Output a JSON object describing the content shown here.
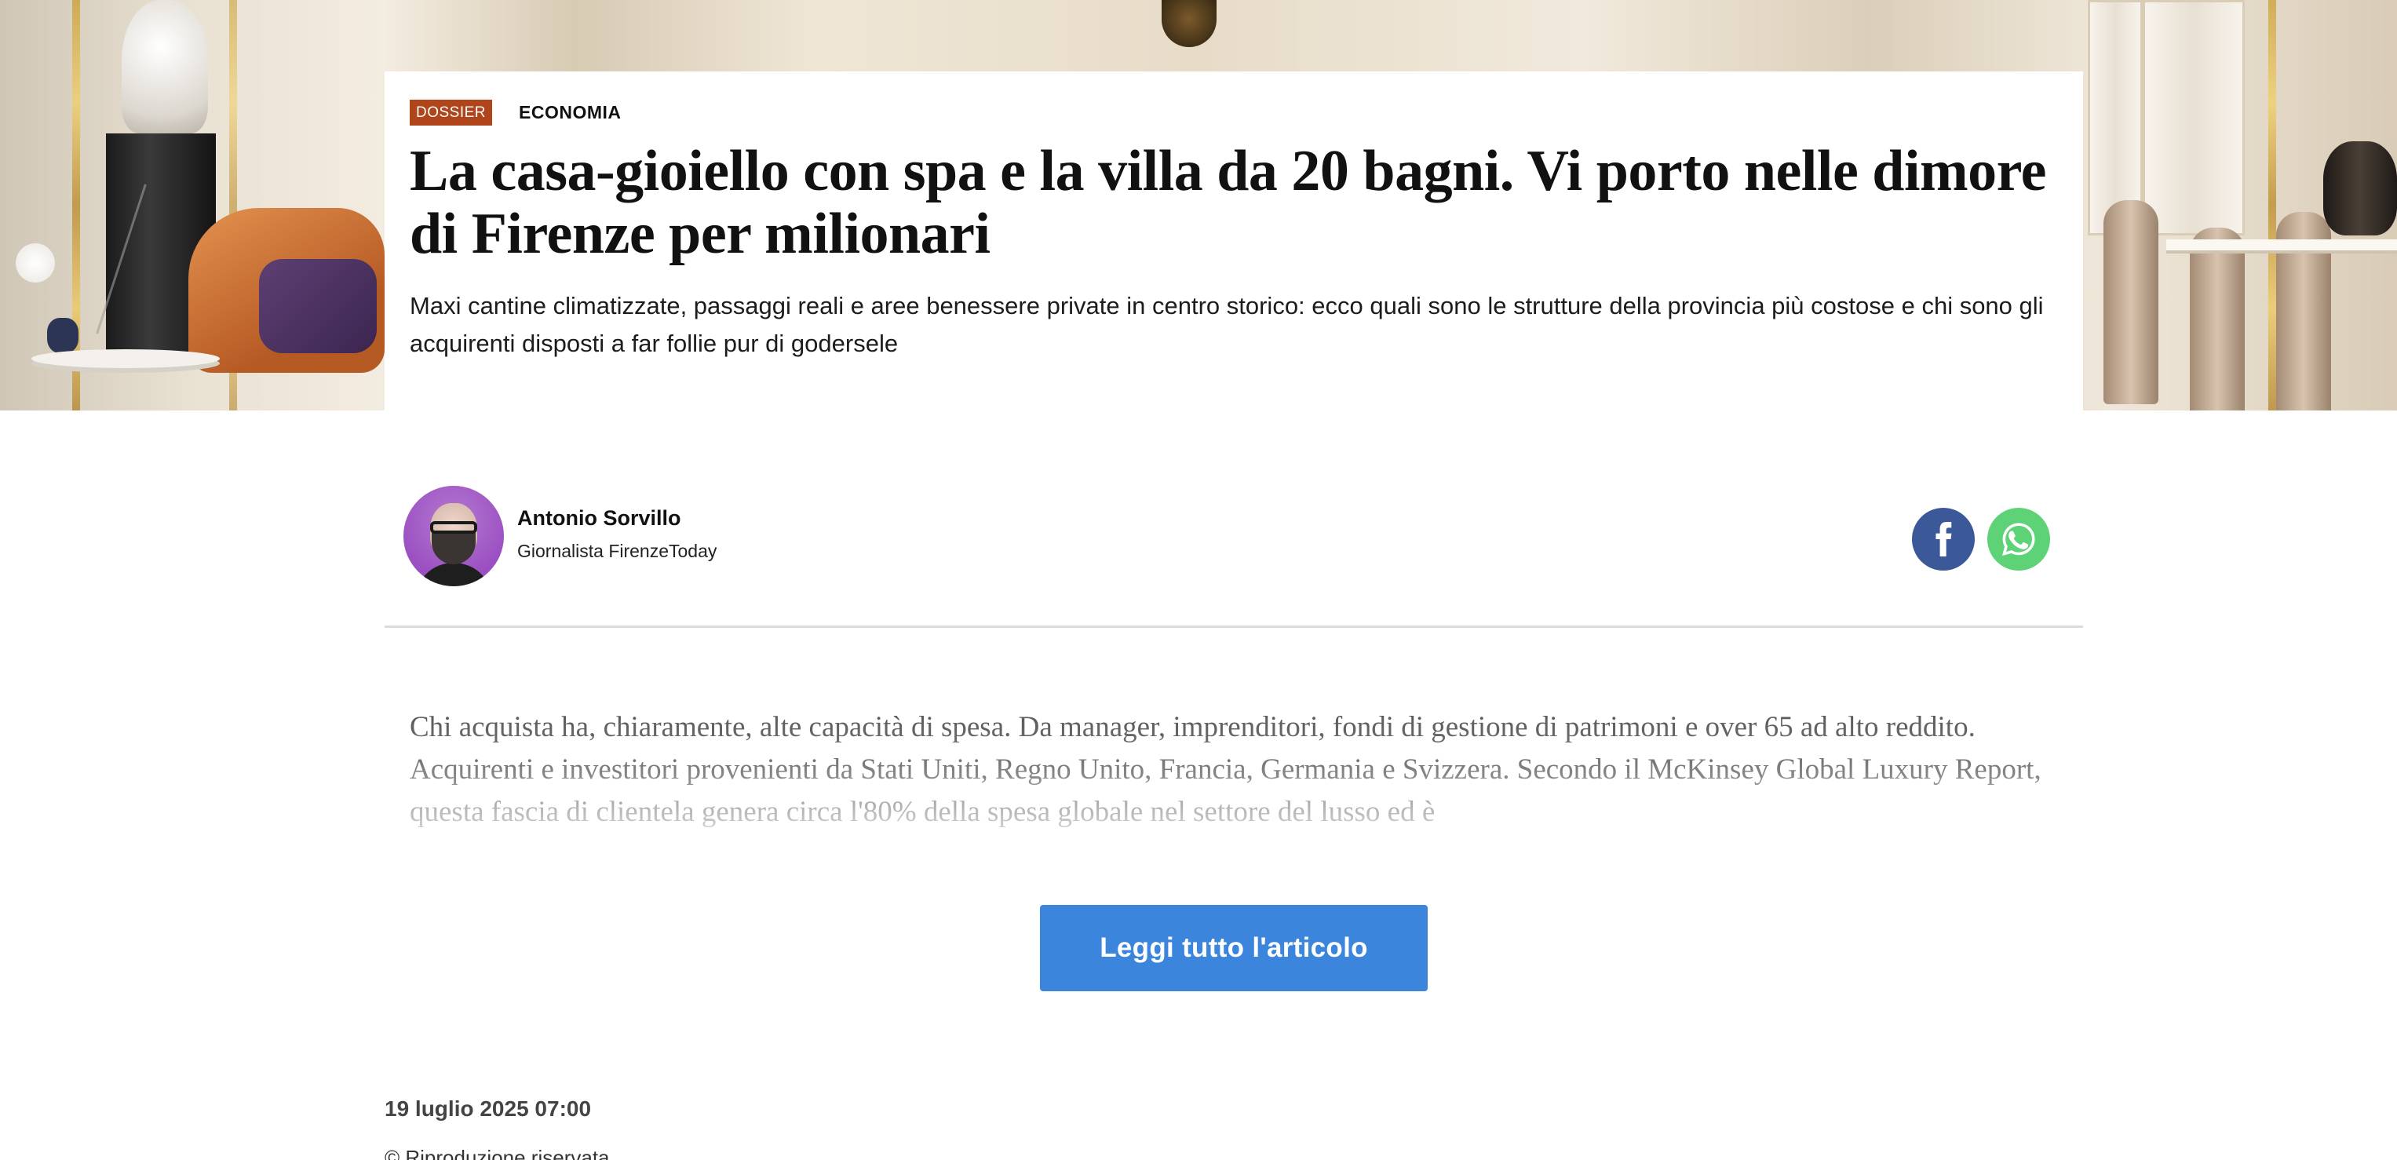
{
  "article": {
    "tag_dossier": "DOSSIER",
    "category": "ECONOMIA",
    "headline": "La casa-gioiello con spa e la villa da 20 bagni. Vi porto nelle dimore di Firenze per milionari",
    "subtitle": "Maxi cantine climatizzate, passaggi reali e aree benessere private in centro storico: ecco quali sono le strutture della provincia più costose e chi sono gli acquirenti disposti a far follie pur di godersele",
    "excerpt": "Chi acquista ha, chiaramente, alte capacità di spesa. Da manager, imprenditori, fondi di gestione di patrimoni e over 65 ad alto reddito. Acquirenti e investitori provenienti da Stati Uniti, Regno Unito, Francia, Germania e Svizzera. Secondo il McKinsey Global Luxury Report, questa fascia di clientela genera circa l'80% della spesa globale nel settore del lusso ed è",
    "read_more_label": "Leggi tutto l'articolo",
    "date": "19 luglio 2025 07:00",
    "copyright": "© Riproduzione riservata"
  },
  "author": {
    "name": "Antonio Sorvillo",
    "role": "Giornalista FirenzeToday"
  },
  "share": {
    "facebook_icon": "facebook-icon",
    "whatsapp_icon": "whatsapp-icon"
  },
  "colors": {
    "tag_background": "#b0451c",
    "read_more_button": "#3b85dc",
    "facebook": "#3b5998",
    "whatsapp": "#5dd276"
  }
}
